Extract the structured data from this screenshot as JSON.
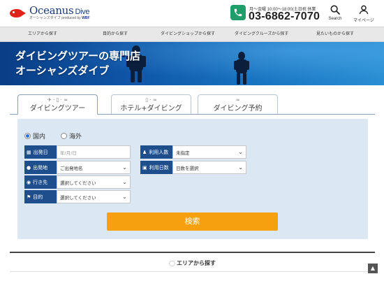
{
  "header": {
    "logo_main": "Oceanus",
    "logo_dive": "Dive",
    "logo_sub": "オーシャンズダイブ",
    "logo_produced": "produced by",
    "logo_brand": "WBF",
    "phone_hours": "月～金曜 10:00～18:00(土日祝 休業",
    "phone_number": "03-6862-7070",
    "search_label": "Search",
    "mypage_label": "マイページ"
  },
  "nav": {
    "items": [
      {
        "label": "エリアから探す"
      },
      {
        "label": "目的から探す"
      },
      {
        "label": "ダイビングショップから探す"
      },
      {
        "label": "ダイビングクルーズから探す"
      },
      {
        "label": "見たいものから探す"
      }
    ]
  },
  "banner": {
    "line1": "ダイビングツアーの専門店",
    "line2": "オーシャンズダイブ"
  },
  "tabs": [
    {
      "label": "ダイビングツアー",
      "icons": "✈ · ▯ · ≈",
      "active": true
    },
    {
      "label": "ホテル+ダイビング",
      "icons": "▯ · ≈",
      "active": false
    },
    {
      "label": "ダイビング予約",
      "icons": "≈",
      "active": false
    }
  ],
  "form": {
    "radio_domestic": "国内",
    "radio_overseas": "海外",
    "selected_region": "国内",
    "departure_date": {
      "label": "出発日",
      "placeholder": "年/月/日"
    },
    "departure_place": {
      "label": "出発地",
      "value": "ご出発地名"
    },
    "destination": {
      "label": "行き先",
      "value": "選択してください"
    },
    "purpose": {
      "label": "目的",
      "value": "選択してください"
    },
    "people": {
      "label": "利用人数",
      "value": "未指定"
    },
    "days": {
      "label": "利用日数",
      "value": "日数を選択"
    },
    "submit_label": "検索"
  },
  "bottom": {
    "area_title": "エリアから探す",
    "back_top": "▲"
  },
  "colors": {
    "accent_orange": "#f6a00f",
    "field_label_blue": "#1f4e8c",
    "panel_bg": "#dbe7f2",
    "phone_green": "#1f9e6b"
  }
}
